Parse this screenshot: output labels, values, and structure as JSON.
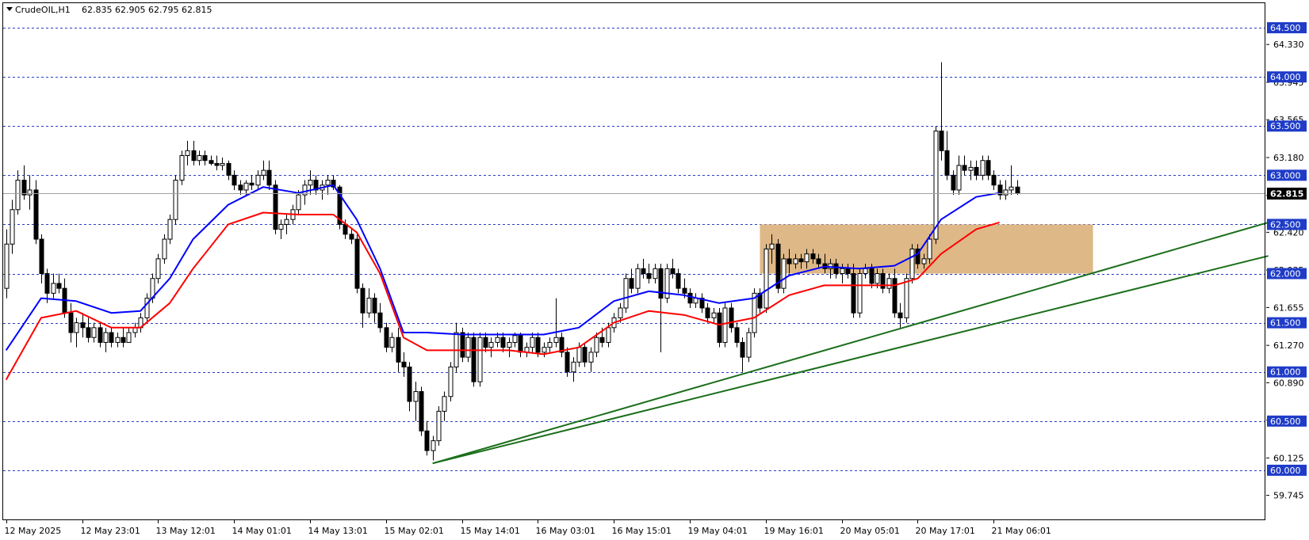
{
  "header": {
    "symbol_label": "CrudeOIL,H1",
    "ohlc_label": "62.835 62.905 62.795 62.815"
  },
  "colors": {
    "background": "#ffffff",
    "grid_level": "#2a3fbf",
    "level_box": "#1f3cc8",
    "current_price_line": "#a0a0a0",
    "current_price_box": "#000000",
    "ema_fast": "#0000ff",
    "ema_slow": "#ff0000",
    "trendline": "#1a6e1a",
    "zone_fill": "#deb887",
    "bull_candle_body": "#ffffff",
    "bear_candle_body": "#000000",
    "candle_outline": "#000000"
  },
  "chart_data": {
    "type": "candlestick",
    "timeframe": "H1",
    "ylim": [
      59.5,
      64.75
    ],
    "y_ticks": [
      "64.330",
      "63.945",
      "63.565",
      "63.180",
      "62.795",
      "62.420",
      "62.035",
      "61.655",
      "61.270",
      "60.890",
      "60.510",
      "60.125",
      "59.745"
    ],
    "level_lines": [
      "64.500",
      "64.000",
      "63.500",
      "63.000",
      "62.500",
      "62.000",
      "61.500",
      "61.000",
      "60.500",
      "60.000"
    ],
    "current_price": "62.815",
    "x_labels": [
      "12 May 2025",
      "12 May 23:01",
      "13 May 12:01",
      "14 May 01:01",
      "14 May 13:01",
      "15 May 02:01",
      "15 May 14:01",
      "16 May 03:01",
      "16 May 15:01",
      "19 May 04:01",
      "19 May 16:01",
      "20 May 05:01",
      "20 May 17:01",
      "21 May 06:01"
    ],
    "x_label_bars": [
      0,
      13,
      26,
      39,
      52,
      65,
      78,
      91,
      104,
      117,
      130,
      143,
      156,
      169
    ],
    "total_bars": 216,
    "candles": [
      [
        61.85,
        62.45,
        61.75,
        62.3
      ],
      [
        62.3,
        62.75,
        62.2,
        62.65
      ],
      [
        62.65,
        63.05,
        62.6,
        62.95
      ],
      [
        62.95,
        63.1,
        62.75,
        62.8
      ],
      [
        62.8,
        63.0,
        62.65,
        62.85
      ],
      [
        62.85,
        62.95,
        62.3,
        62.35
      ],
      [
        62.35,
        62.4,
        61.9,
        62.0
      ],
      [
        62.0,
        62.05,
        61.7,
        61.8
      ],
      [
        61.8,
        62.0,
        61.75,
        61.9
      ],
      [
        61.9,
        62.0,
        61.8,
        61.85
      ],
      [
        61.85,
        61.95,
        61.55,
        61.6
      ],
      [
        61.6,
        61.7,
        61.3,
        61.4
      ],
      [
        61.4,
        61.55,
        61.25,
        61.5
      ],
      [
        61.5,
        61.6,
        61.35,
        61.45
      ],
      [
        61.45,
        61.55,
        61.3,
        61.35
      ],
      [
        61.35,
        61.5,
        61.3,
        61.45
      ],
      [
        61.45,
        61.5,
        61.25,
        61.3
      ],
      [
        61.3,
        61.45,
        61.2,
        61.4
      ],
      [
        61.4,
        61.45,
        61.25,
        61.3
      ],
      [
        61.3,
        61.4,
        61.25,
        61.35
      ],
      [
        61.35,
        61.45,
        61.25,
        61.3
      ],
      [
        61.3,
        61.45,
        61.3,
        61.4
      ],
      [
        61.4,
        61.5,
        61.35,
        61.45
      ],
      [
        61.45,
        61.6,
        61.4,
        61.55
      ],
      [
        61.55,
        61.8,
        61.5,
        61.75
      ],
      [
        61.75,
        62.0,
        61.7,
        61.95
      ],
      [
        61.95,
        62.2,
        61.9,
        62.15
      ],
      [
        62.15,
        62.4,
        62.1,
        62.35
      ],
      [
        62.35,
        62.6,
        62.3,
        62.55
      ],
      [
        62.55,
        63.0,
        62.5,
        62.95
      ],
      [
        62.95,
        63.25,
        62.9,
        63.2
      ],
      [
        63.2,
        63.35,
        63.1,
        63.25
      ],
      [
        63.25,
        63.35,
        63.1,
        63.15
      ],
      [
        63.15,
        63.25,
        63.1,
        63.2
      ],
      [
        63.2,
        63.25,
        63.1,
        63.15
      ],
      [
        63.15,
        63.2,
        63.1,
        63.12
      ],
      [
        63.12,
        63.2,
        63.05,
        63.1
      ],
      [
        63.1,
        63.18,
        63.05,
        63.12
      ],
      [
        63.12,
        63.15,
        62.95,
        63.0
      ],
      [
        63.0,
        63.05,
        62.85,
        62.9
      ],
      [
        62.9,
        62.95,
        62.8,
        62.85
      ],
      [
        62.85,
        62.95,
        62.8,
        62.92
      ],
      [
        62.92,
        63.0,
        62.85,
        62.9
      ],
      [
        62.9,
        63.05,
        62.85,
        63.0
      ],
      [
        63.0,
        63.15,
        62.95,
        63.05
      ],
      [
        63.05,
        63.15,
        62.85,
        62.9
      ],
      [
        62.9,
        62.95,
        62.4,
        62.45
      ],
      [
        62.45,
        62.55,
        62.35,
        62.5
      ],
      [
        62.5,
        62.6,
        62.4,
        62.55
      ],
      [
        62.55,
        62.7,
        62.5,
        62.65
      ],
      [
        62.65,
        62.85,
        62.6,
        62.8
      ],
      [
        62.8,
        62.95,
        62.7,
        62.9
      ],
      [
        62.9,
        63.05,
        62.8,
        62.95
      ],
      [
        62.95,
        63.0,
        62.8,
        62.85
      ],
      [
        62.85,
        62.95,
        62.75,
        62.9
      ],
      [
        62.9,
        63.0,
        62.8,
        62.95
      ],
      [
        62.95,
        63.0,
        62.85,
        62.88
      ],
      [
        62.88,
        62.9,
        62.45,
        62.5
      ],
      [
        62.5,
        62.55,
        62.35,
        62.4
      ],
      [
        62.4,
        62.45,
        62.3,
        62.35
      ],
      [
        62.35,
        62.4,
        61.8,
        61.85
      ],
      [
        61.85,
        61.9,
        61.45,
        61.6
      ],
      [
        61.6,
        61.85,
        61.55,
        61.75
      ],
      [
        61.75,
        61.8,
        61.5,
        61.6
      ],
      [
        61.6,
        61.7,
        61.4,
        61.45
      ],
      [
        61.45,
        61.5,
        61.2,
        61.25
      ],
      [
        61.25,
        61.4,
        61.2,
        61.35
      ],
      [
        61.35,
        61.45,
        61.0,
        61.1
      ],
      [
        61.1,
        61.2,
        60.95,
        61.05
      ],
      [
        61.05,
        61.1,
        60.6,
        60.7
      ],
      [
        60.7,
        60.9,
        60.5,
        60.8
      ],
      [
        60.8,
        60.85,
        60.35,
        60.4
      ],
      [
        60.4,
        60.5,
        60.15,
        60.2
      ],
      [
        60.2,
        60.35,
        60.1,
        60.3
      ],
      [
        60.3,
        60.65,
        60.25,
        60.6
      ],
      [
        60.6,
        60.8,
        60.5,
        60.75
      ],
      [
        60.75,
        61.1,
        60.7,
        61.05
      ],
      [
        61.05,
        61.5,
        61.0,
        61.4
      ],
      [
        61.4,
        61.45,
        61.1,
        61.15
      ],
      [
        61.15,
        61.4,
        61.1,
        61.35
      ],
      [
        61.35,
        61.4,
        60.85,
        60.9
      ],
      [
        60.9,
        61.4,
        60.85,
        61.35
      ],
      [
        61.35,
        61.4,
        61.2,
        61.25
      ],
      [
        61.25,
        61.35,
        61.15,
        61.3
      ],
      [
        61.3,
        61.4,
        61.25,
        61.35
      ],
      [
        61.35,
        61.4,
        61.2,
        61.25
      ],
      [
        61.25,
        61.35,
        61.15,
        61.3
      ],
      [
        61.3,
        61.4,
        61.25,
        61.37
      ],
      [
        61.37,
        61.4,
        61.15,
        61.2
      ],
      [
        61.2,
        61.3,
        61.15,
        61.25
      ],
      [
        61.25,
        61.4,
        61.2,
        61.35
      ],
      [
        61.35,
        61.4,
        61.15,
        61.2
      ],
      [
        61.2,
        61.3,
        61.15,
        61.25
      ],
      [
        61.25,
        61.35,
        61.2,
        61.3
      ],
      [
        61.3,
        61.75,
        61.25,
        61.35
      ],
      [
        61.35,
        61.4,
        61.15,
        61.2
      ],
      [
        61.2,
        61.25,
        60.95,
        61.0
      ],
      [
        61.0,
        61.15,
        60.9,
        61.1
      ],
      [
        61.1,
        61.3,
        61.05,
        61.25
      ],
      [
        61.25,
        61.3,
        61.05,
        61.1
      ],
      [
        61.1,
        61.25,
        61.0,
        61.2
      ],
      [
        61.2,
        61.4,
        61.15,
        61.35
      ],
      [
        61.35,
        61.45,
        61.25,
        61.3
      ],
      [
        61.3,
        61.5,
        61.25,
        61.45
      ],
      [
        61.45,
        61.6,
        61.4,
        61.55
      ],
      [
        61.55,
        61.7,
        61.5,
        61.65
      ],
      [
        61.65,
        62.0,
        61.6,
        61.95
      ],
      [
        61.95,
        62.05,
        61.8,
        61.85
      ],
      [
        61.85,
        62.1,
        61.8,
        62.05
      ],
      [
        62.05,
        62.15,
        61.95,
        62.0
      ],
      [
        62.0,
        62.1,
        61.9,
        61.95
      ],
      [
        61.95,
        62.1,
        61.9,
        62.05
      ],
      [
        62.05,
        62.1,
        61.2,
        61.75
      ],
      [
        61.75,
        62.1,
        61.7,
        62.05
      ],
      [
        62.05,
        62.15,
        61.95,
        62.0
      ],
      [
        62.0,
        62.05,
        61.8,
        61.85
      ],
      [
        61.85,
        61.95,
        61.75,
        61.8
      ],
      [
        61.8,
        61.85,
        61.65,
        61.7
      ],
      [
        61.7,
        61.8,
        61.65,
        61.75
      ],
      [
        61.75,
        61.8,
        61.6,
        61.65
      ],
      [
        61.65,
        61.7,
        61.5,
        61.55
      ],
      [
        61.55,
        61.65,
        61.5,
        61.6
      ],
      [
        61.6,
        61.65,
        61.25,
        61.3
      ],
      [
        61.3,
        61.7,
        61.25,
        61.65
      ],
      [
        61.65,
        61.7,
        61.4,
        61.45
      ],
      [
        61.45,
        61.5,
        61.25,
        61.3
      ],
      [
        61.3,
        61.35,
        61.0,
        61.15
      ],
      [
        61.15,
        61.45,
        61.1,
        61.4
      ],
      [
        61.4,
        61.85,
        61.35,
        61.8
      ],
      [
        61.8,
        61.85,
        61.6,
        61.65
      ],
      [
        61.65,
        62.3,
        61.6,
        62.25
      ],
      [
        62.25,
        62.4,
        62.1,
        62.3
      ],
      [
        62.3,
        62.35,
        61.8,
        61.85
      ],
      [
        61.85,
        62.2,
        61.8,
        62.15
      ],
      [
        62.15,
        62.25,
        62.0,
        62.1
      ],
      [
        62.1,
        62.2,
        62.05,
        62.15
      ],
      [
        62.15,
        62.2,
        62.05,
        62.12
      ],
      [
        62.12,
        62.25,
        62.05,
        62.2
      ],
      [
        62.2,
        62.25,
        62.1,
        62.15
      ],
      [
        62.15,
        62.2,
        62.05,
        62.1
      ],
      [
        62.1,
        62.2,
        62.0,
        62.05
      ],
      [
        62.05,
        62.15,
        61.95,
        62.1
      ],
      [
        62.1,
        62.15,
        61.95,
        62.0
      ],
      [
        62.0,
        62.1,
        61.9,
        62.05
      ],
      [
        62.05,
        62.1,
        61.95,
        62.0
      ],
      [
        62.0,
        62.1,
        61.55,
        61.6
      ],
      [
        61.6,
        62.05,
        61.55,
        62.0
      ],
      [
        62.0,
        62.1,
        61.95,
        62.05
      ],
      [
        62.05,
        62.1,
        61.85,
        61.9
      ],
      [
        61.9,
        62.05,
        61.85,
        62.0
      ],
      [
        62.0,
        62.05,
        61.8,
        61.85
      ],
      [
        61.85,
        62.0,
        61.8,
        61.95
      ],
      [
        61.95,
        62.05,
        61.55,
        61.6
      ],
      [
        61.6,
        61.7,
        61.45,
        61.55
      ],
      [
        61.55,
        62.0,
        61.5,
        61.95
      ],
      [
        61.95,
        62.3,
        61.9,
        62.25
      ],
      [
        62.25,
        62.3,
        62.05,
        62.1
      ],
      [
        62.1,
        62.2,
        62.05,
        62.15
      ],
      [
        62.15,
        62.4,
        62.1,
        62.35
      ],
      [
        62.35,
        63.5,
        62.3,
        63.45
      ],
      [
        63.45,
        64.15,
        63.15,
        63.25
      ],
      [
        63.25,
        63.45,
        62.95,
        63.0
      ],
      [
        63.0,
        63.05,
        62.8,
        62.85
      ],
      [
        62.85,
        63.2,
        62.8,
        63.1
      ],
      [
        63.1,
        63.2,
        63.0,
        63.05
      ],
      [
        63.05,
        63.15,
        62.95,
        63.08
      ],
      [
        63.08,
        63.15,
        62.95,
        63.0
      ],
      [
        63.0,
        63.2,
        62.95,
        63.15
      ],
      [
        63.15,
        63.2,
        62.95,
        63.0
      ],
      [
        63.0,
        63.05,
        62.85,
        62.9
      ],
      [
        62.9,
        62.95,
        62.75,
        62.8
      ],
      [
        62.8,
        62.95,
        62.75,
        62.85
      ],
      [
        62.85,
        63.1,
        62.8,
        62.88
      ],
      [
        62.88,
        62.95,
        62.8,
        62.815
      ]
    ],
    "ema_fast": [
      [
        0,
        61.22
      ],
      [
        6,
        61.75
      ],
      [
        12,
        61.72
      ],
      [
        18,
        61.6
      ],
      [
        23,
        61.62
      ],
      [
        28,
        61.95
      ],
      [
        32,
        62.35
      ],
      [
        38,
        62.7
      ],
      [
        44,
        62.88
      ],
      [
        50,
        62.82
      ],
      [
        56,
        62.9
      ],
      [
        60,
        62.55
      ],
      [
        64,
        62.05
      ],
      [
        68,
        61.4
      ],
      [
        72,
        61.4
      ],
      [
        78,
        61.38
      ],
      [
        86,
        61.38
      ],
      [
        92,
        61.38
      ],
      [
        98,
        61.45
      ],
      [
        104,
        61.72
      ],
      [
        110,
        61.82
      ],
      [
        116,
        61.78
      ],
      [
        122,
        61.7
      ],
      [
        128,
        61.75
      ],
      [
        134,
        61.98
      ],
      [
        140,
        62.07
      ],
      [
        146,
        62.05
      ],
      [
        152,
        62.08
      ],
      [
        156,
        62.2
      ],
      [
        160,
        62.55
      ],
      [
        166,
        62.78
      ],
      [
        170,
        62.82
      ]
    ],
    "ema_slow": [
      [
        0,
        60.92
      ],
      [
        6,
        61.55
      ],
      [
        12,
        61.62
      ],
      [
        18,
        61.45
      ],
      [
        23,
        61.45
      ],
      [
        28,
        61.7
      ],
      [
        32,
        62.05
      ],
      [
        38,
        62.5
      ],
      [
        44,
        62.62
      ],
      [
        50,
        62.6
      ],
      [
        56,
        62.6
      ],
      [
        60,
        62.42
      ],
      [
        64,
        62.0
      ],
      [
        68,
        61.35
      ],
      [
        72,
        61.22
      ],
      [
        78,
        61.22
      ],
      [
        86,
        61.22
      ],
      [
        92,
        61.18
      ],
      [
        98,
        61.25
      ],
      [
        104,
        61.5
      ],
      [
        110,
        61.62
      ],
      [
        116,
        61.58
      ],
      [
        122,
        61.48
      ],
      [
        128,
        61.55
      ],
      [
        134,
        61.78
      ],
      [
        140,
        61.88
      ],
      [
        146,
        61.88
      ],
      [
        152,
        61.88
      ],
      [
        156,
        61.95
      ],
      [
        160,
        62.2
      ],
      [
        166,
        62.45
      ],
      [
        170,
        62.52
      ]
    ],
    "trendlines": [
      {
        "from": [
          73,
          60.07
        ],
        "to": [
          216,
          62.52
        ]
      },
      {
        "from": [
          73,
          60.07
        ],
        "to": [
          216,
          62.18
        ]
      }
    ],
    "zone": {
      "from_bar": 129,
      "to_bar": 186,
      "price_low": 62.0,
      "price_high": 62.5
    }
  }
}
